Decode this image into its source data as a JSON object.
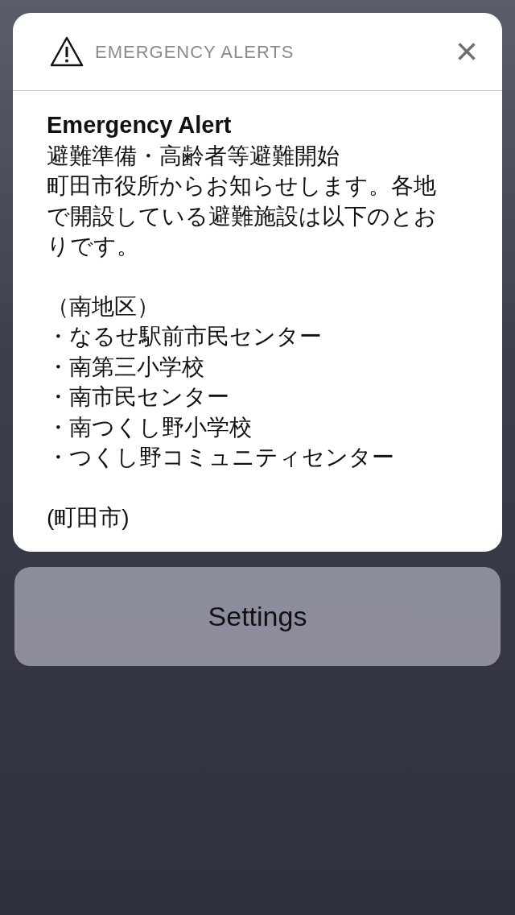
{
  "notification": {
    "app_name": "EMERGENCY ALERTS",
    "close": "×",
    "title": "Emergency Alert",
    "subtitle": "避難準備・高齢者等避難開始",
    "message": "町田市役所からお知らせします。各地で開設している避難施設は以下のとおりです。",
    "district": "（南地区）",
    "facilities": [
      "・なるせ駅前市民センター",
      "・南第三小学校",
      "・南市民センター",
      "・南つくし野小学校",
      "・つくし野コミュニティセンター"
    ],
    "footer": "(町田市)"
  },
  "settings_button": {
    "label": "Settings"
  }
}
